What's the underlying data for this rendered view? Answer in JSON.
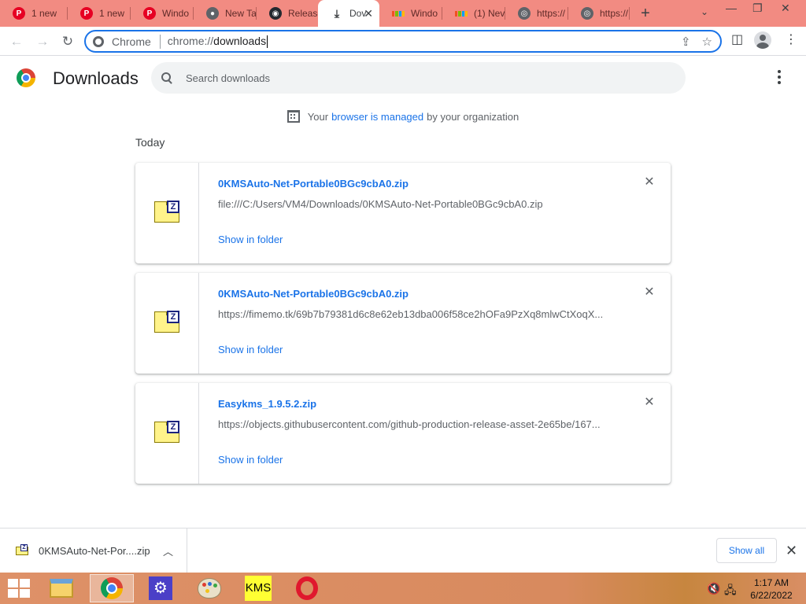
{
  "browser": {
    "tabs": [
      {
        "label": "1 new",
        "icon": "pinterest-icon",
        "color": "#e60023"
      },
      {
        "label": "1 new",
        "icon": "pinterest-icon",
        "color": "#e60023"
      },
      {
        "label": "Windo",
        "icon": "pinterest-icon",
        "color": "#e60023"
      },
      {
        "label": "New Ta",
        "icon": "chrome-icon",
        "color": "#5f6368"
      },
      {
        "label": "Release",
        "icon": "github-icon",
        "color": "#24292f"
      },
      {
        "label": "Dov",
        "icon": "download-icon",
        "color": "#3c4043",
        "active": true
      },
      {
        "label": "Windo",
        "icon": "microsoft-icon",
        "color": "#f25022"
      },
      {
        "label": "(1) Nev",
        "icon": "microsoft-icon",
        "color": "#f25022"
      },
      {
        "label": "https://",
        "icon": "globe-icon",
        "color": "#5f6368"
      },
      {
        "label": "https://",
        "icon": "globe-icon",
        "color": "#5f6368"
      }
    ],
    "omnibox": {
      "site_label": "Chrome",
      "url_scheme": "chrome://",
      "url_path": "downloads"
    }
  },
  "page": {
    "title": "Downloads",
    "search_placeholder": "Search downloads",
    "managed_prefix": "Your",
    "managed_link": "browser is managed",
    "managed_suffix": "by your organization",
    "date_heading": "Today"
  },
  "downloads": [
    {
      "name": "0KMSAuto-Net-Portable0BGc9cbA0.zip",
      "url": "file:///C:/Users/VM4/Downloads/0KMSAuto-Net-Portable0BGc9cbA0.zip",
      "action": "Show in folder"
    },
    {
      "name": "0KMSAuto-Net-Portable0BGc9cbA0.zip",
      "url": "https://fimemo.tk/69b7b79381d6c8e62eb13dba006f58ce2hOFa9PzXq8mlwCtXoqX...",
      "action": "Show in folder"
    },
    {
      "name": "Easykms_1.9.5.2.zip",
      "url": "https://objects.githubusercontent.com/github-production-release-asset-2e65be/167...",
      "action": "Show in folder"
    }
  ],
  "shelf": {
    "item_name": "0KMSAuto-Net-Por....zip",
    "show_all": "Show all"
  },
  "taskbar": {
    "kms_label": "KMS",
    "time": "1:17 AM",
    "date": "6/22/2022"
  },
  "colors": {
    "tabstrip": "#f28b82",
    "accent": "#1a73e8",
    "taskbar": "#d88a62"
  }
}
